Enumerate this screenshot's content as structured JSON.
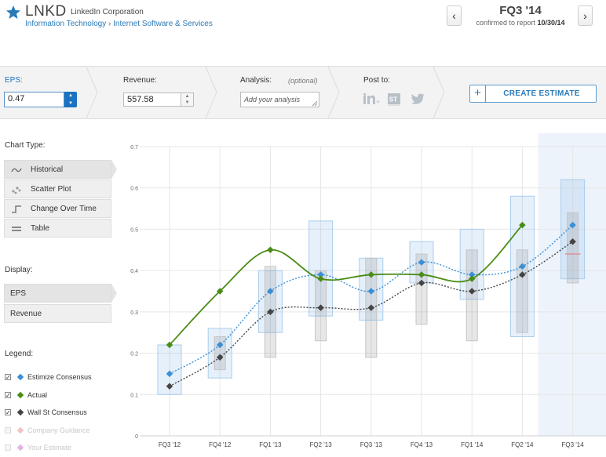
{
  "header": {
    "ticker": "LNKD",
    "company": "LinkedIn Corporation",
    "sector": "Information Technology",
    "crumb_sep": "›",
    "industry": "Internet Software & Services",
    "quarter": "FQ3 '14",
    "confirm_prefix": "confirmed to report",
    "confirm_date": "10/30/14",
    "prev_glyph": "‹",
    "next_glyph": "›"
  },
  "toolbar": {
    "eps_label": "EPS:",
    "eps_value": "0.47",
    "revenue_label": "Revenue:",
    "revenue_value": "557.58",
    "analysis_label": "Analysis:",
    "analysis_optional": "(optional)",
    "analysis_placeholder": "Add your analysis",
    "post_label": "Post to:",
    "create_plus": "+",
    "create_label": "CREATE ESTIMATE"
  },
  "sidebar": {
    "chart_type_heading": "Chart Type:",
    "chart_types": [
      {
        "label": "Historical",
        "icon": "wave-icon",
        "active": true
      },
      {
        "label": "Scatter Plot",
        "icon": "scatter-icon",
        "active": false
      },
      {
        "label": "Change Over Time",
        "icon": "step-icon",
        "active": false
      },
      {
        "label": "Table",
        "icon": "table-icon",
        "active": false
      }
    ],
    "display_heading": "Display:",
    "display": [
      {
        "label": "EPS",
        "active": true
      },
      {
        "label": "Revenue",
        "active": false
      }
    ],
    "legend_heading": "Legend:",
    "legend": [
      {
        "label": "Estimize Consensus",
        "checked": true,
        "color": "#3b8fd6"
      },
      {
        "label": "Actual",
        "checked": true,
        "color": "#4a8c16"
      },
      {
        "label": "Wall St Consensus",
        "checked": true,
        "color": "#444444"
      },
      {
        "label": "Company Guidance",
        "checked": false,
        "color": "#f2c3c3"
      },
      {
        "label": "Your Estimate",
        "checked": false,
        "color": "#e3b4e3"
      }
    ]
  },
  "colors": {
    "accent": "#1a73c0",
    "estimize": "#3b8fd6",
    "actual": "#4a8c16",
    "wallst": "#444444"
  },
  "chart_data": {
    "type": "line",
    "categories": [
      "FQ3 '12",
      "FQ4 '12",
      "FQ1 '13",
      "FQ2 '13",
      "FQ3 '13",
      "FQ4 '13",
      "FQ1 '14",
      "FQ2 '14",
      "FQ3 '14"
    ],
    "ylim": [
      0,
      0.7
    ],
    "yticks": [
      "0",
      "0.1",
      "0.2",
      "0.3",
      "0.4",
      "0.5",
      "0.6",
      "0.7"
    ],
    "grid": true,
    "highlighted_category": "FQ3 '14",
    "series": [
      {
        "name": "Estimize Consensus",
        "values": [
          0.15,
          0.22,
          0.35,
          0.39,
          0.35,
          0.42,
          0.39,
          0.41,
          0.51
        ]
      },
      {
        "name": "Actual",
        "values": [
          0.22,
          0.35,
          0.45,
          0.38,
          0.39,
          0.39,
          0.38,
          0.51,
          null
        ]
      },
      {
        "name": "Wall St Consensus",
        "values": [
          0.12,
          0.19,
          0.3,
          0.31,
          0.31,
          0.37,
          0.35,
          0.39,
          0.47
        ]
      }
    ],
    "estimize_ranges": [
      [
        0.1,
        0.22
      ],
      [
        0.14,
        0.26
      ],
      [
        0.25,
        0.4
      ],
      [
        0.29,
        0.52
      ],
      [
        0.28,
        0.43
      ],
      [
        0.37,
        0.47
      ],
      [
        0.33,
        0.5
      ],
      [
        0.24,
        0.58
      ],
      [
        0.38,
        0.62
      ]
    ],
    "wallst_ranges": [
      null,
      [
        0.16,
        0.24
      ],
      [
        0.19,
        0.41
      ],
      [
        0.23,
        0.4
      ],
      [
        0.19,
        0.43
      ],
      [
        0.27,
        0.44
      ],
      [
        0.23,
        0.45
      ],
      [
        0.25,
        0.45
      ],
      [
        0.37,
        0.54
      ]
    ],
    "company_guidance": [
      null,
      null,
      null,
      null,
      null,
      null,
      null,
      null,
      0.44
    ]
  }
}
